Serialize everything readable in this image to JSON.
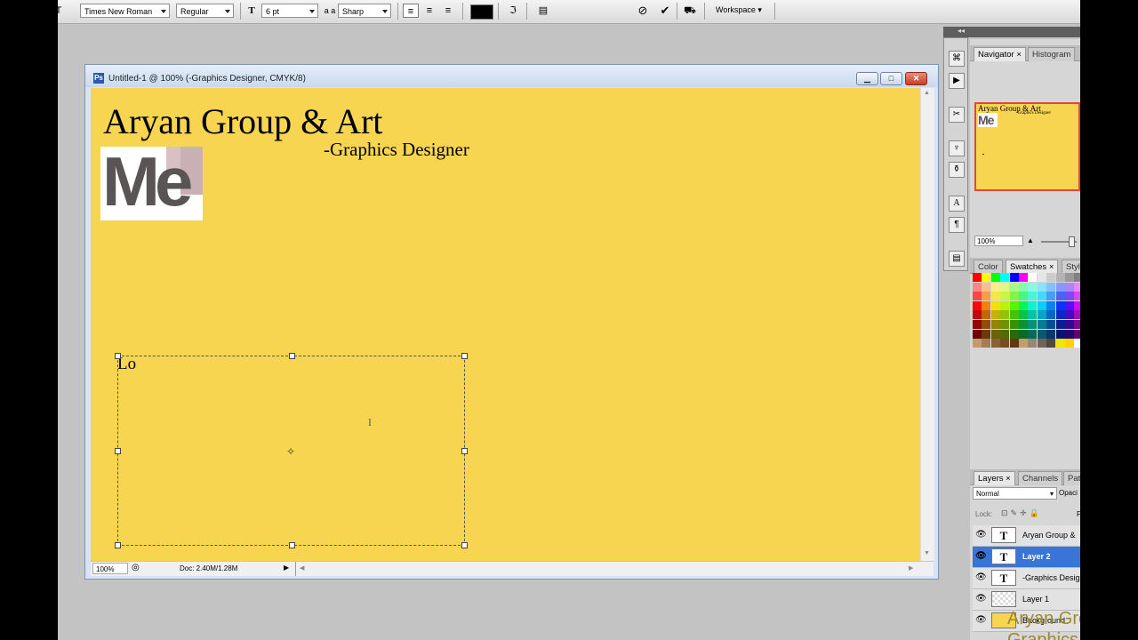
{
  "options_bar": {
    "font_family": "Times New Roman",
    "font_style": "Regular",
    "font_size": "6 pt",
    "aa_icon_label": "a a",
    "anti_alias": "Sharp",
    "workspace": "Workspace",
    "text_color": "#000000"
  },
  "document": {
    "title": "Untitled-1 @ 100% (-Graphics Designer, CMYK/8)",
    "icon_label": "Ps",
    "canvas_color": "#f8d550",
    "heading": "Aryan Group & Art",
    "subheading": "-Graphics Designer",
    "logo_text": "Me",
    "textbox_text": "Lo",
    "zoom": "100%",
    "doc_info": "Doc: 2.40M/1.28M"
  },
  "navigator": {
    "tabs": [
      "Navigator",
      "Histogram"
    ],
    "thumb_heading": "Aryan Group & Art",
    "thumb_sub": "-Graphics Designer",
    "thumb_logo": "Me",
    "zoom": "100%"
  },
  "color_panel": {
    "tabs": [
      "Color",
      "Swatches",
      "Styl"
    ]
  },
  "layers_panel": {
    "tabs": [
      "Layers",
      "Channels",
      "Pat"
    ],
    "blend_mode": "Normal",
    "opacity_label": "Opaci",
    "lock_label": "Lock:",
    "fill_label": "F",
    "layers": [
      {
        "name": "Aryan Group &",
        "thumb": "T",
        "active": false
      },
      {
        "name": "Layer 2",
        "thumb": "T",
        "active": true
      },
      {
        "name": "-Graphics Design",
        "thumb": "T",
        "active": false
      },
      {
        "name": "Layer 1",
        "thumb": "",
        "active": false
      },
      {
        "name": "Background",
        "thumb": "",
        "active": false
      }
    ]
  },
  "watermark": {
    "line1": "Aryan Group &",
    "line2": "Graphics Design"
  }
}
